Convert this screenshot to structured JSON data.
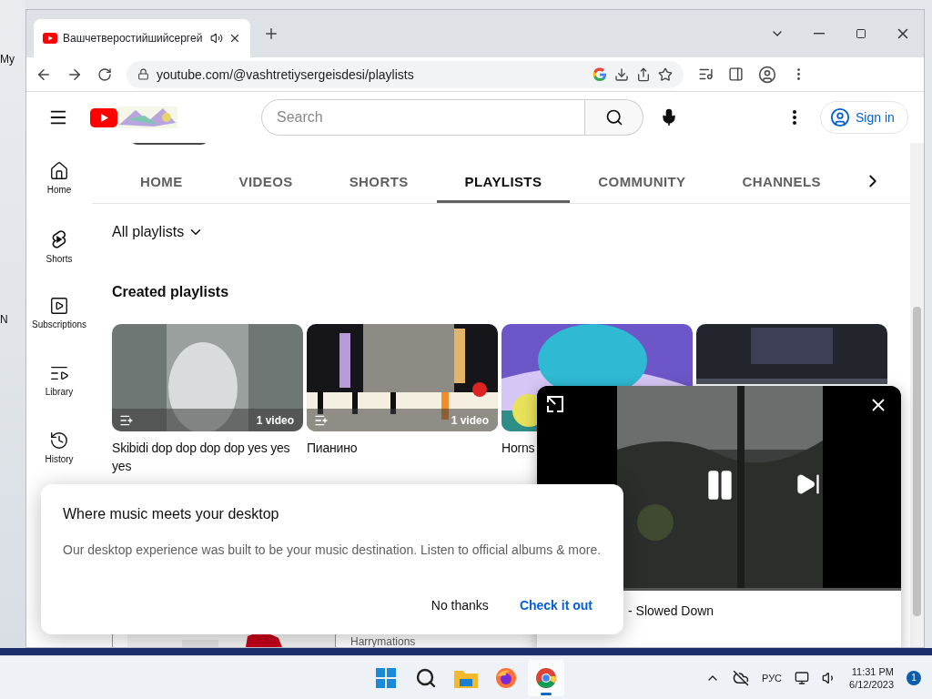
{
  "desktop_labels": [
    "My",
    "N"
  ],
  "browser": {
    "tab_title": "Вашчетверостийшийсергей",
    "audio": true,
    "url": "youtube.com/@vashtretiysergeisdesi/playlists"
  },
  "masthead": {
    "search_placeholder": "Search",
    "sign_in": "Sign in"
  },
  "sidebar": [
    {
      "kind": "home",
      "label": "Home"
    },
    {
      "kind": "shorts",
      "label": "Shorts"
    },
    {
      "kind": "subscriptions",
      "label": "Subscriptions"
    },
    {
      "kind": "library",
      "label": "Library"
    },
    {
      "kind": "history",
      "label": "History"
    }
  ],
  "channel_tabs": [
    {
      "label": "HOME",
      "selected": false
    },
    {
      "label": "VIDEOS",
      "selected": false
    },
    {
      "label": "SHORTS",
      "selected": false
    },
    {
      "label": "PLAYLISTS",
      "selected": true
    },
    {
      "label": "COMMUNITY",
      "selected": false
    },
    {
      "label": "CHANNELS",
      "selected": false
    }
  ],
  "filter": "All playlists",
  "section_title": "Created playlists",
  "playlists": [
    {
      "title": "Skibidi dop dop dop dop yes yes yes",
      "count": "1 video"
    },
    {
      "title": "Пианино",
      "count": "1 video"
    },
    {
      "title": "Horns"
    },
    {
      "kind": "picture"
    }
  ],
  "second_row": [
    {
      "kind": "picture"
    },
    {
      "channel": "Harrymations"
    }
  ],
  "dialog": {
    "title": "Where music meets your desktop",
    "body": "Our desktop experience was built to be your music destination. Listen to official albums & more.",
    "buttons": [
      {
        "label": "No thanks",
        "kind": "plain"
      },
      {
        "label": "Check it out",
        "kind": "primary"
      }
    ]
  },
  "miniplayer": {
    "title": "- Slowed Down",
    "playing": true
  },
  "taskbar": {
    "apps": [
      {
        "kind": "start",
        "selected": false
      },
      {
        "kind": "search",
        "selected": false
      },
      {
        "kind": "files",
        "selected": false
      },
      {
        "kind": "firefox",
        "selected": false
      },
      {
        "kind": "chrome",
        "selected": true
      }
    ],
    "language": "РУС",
    "time": "11:31 PM",
    "date": "6/12/2023",
    "notifications": "1"
  }
}
